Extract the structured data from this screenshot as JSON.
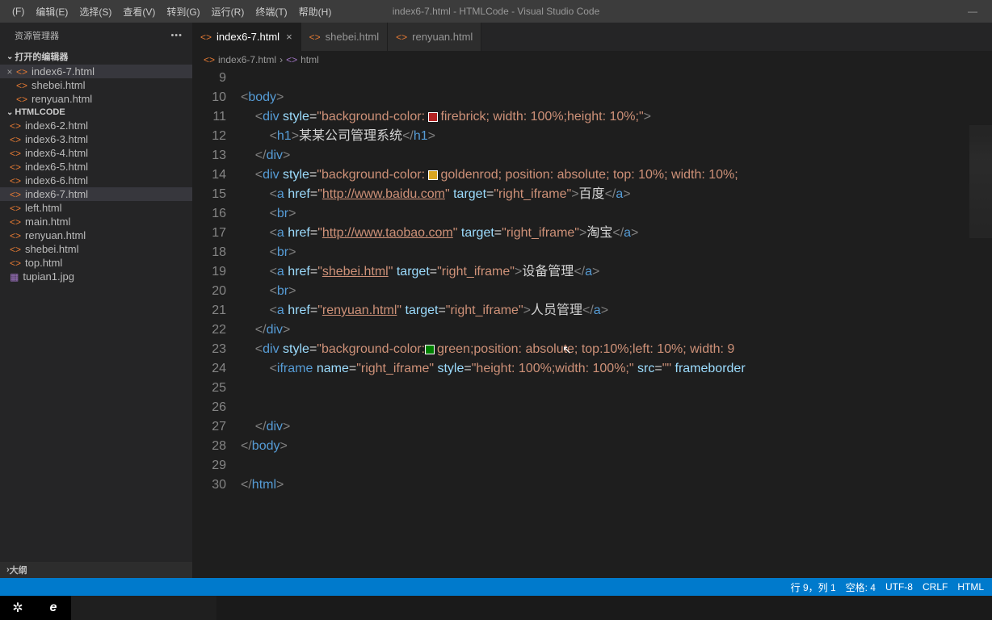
{
  "window": {
    "title": "index6-7.html - HTMLCode - Visual Studio Code"
  },
  "menubar": {
    "items": [
      "(F)",
      "编辑(E)",
      "选择(S)",
      "查看(V)",
      "转到(G)",
      "运行(R)",
      "终端(T)",
      "帮助(H)"
    ]
  },
  "sidebar": {
    "title": "资源管理器",
    "open_editors_label": "打开的编辑器",
    "open_editors": [
      {
        "name": "index6-7.html",
        "active": true
      },
      {
        "name": "shebei.html",
        "active": false
      },
      {
        "name": "renyuan.html",
        "active": false
      }
    ],
    "folder_label": "HTMLCODE",
    "files": [
      {
        "name": "index6-2.html",
        "type": "html",
        "active": false
      },
      {
        "name": "index6-3.html",
        "type": "html",
        "active": false
      },
      {
        "name": "index6-4.html",
        "type": "html",
        "active": false
      },
      {
        "name": "index6-5.html",
        "type": "html",
        "active": false
      },
      {
        "name": "index6-6.html",
        "type": "html",
        "active": false
      },
      {
        "name": "index6-7.html",
        "type": "html",
        "active": true
      },
      {
        "name": "left.html",
        "type": "html",
        "active": false
      },
      {
        "name": "main.html",
        "type": "html",
        "active": false
      },
      {
        "name": "renyuan.html",
        "type": "html",
        "active": false
      },
      {
        "name": "shebei.html",
        "type": "html",
        "active": false
      },
      {
        "name": "top.html",
        "type": "html",
        "active": false
      },
      {
        "name": "tupian1.jpg",
        "type": "img",
        "active": false
      }
    ],
    "outline_label": "大纲"
  },
  "tabs": [
    {
      "name": "index6-7.html",
      "active": true
    },
    {
      "name": "shebei.html",
      "active": false
    },
    {
      "name": "renyuan.html",
      "active": false
    }
  ],
  "breadcrumb": {
    "file": "index6-7.html",
    "symbol": "html"
  },
  "code_lines": {
    "start": 9,
    "end": 30,
    "body_text": "某某公司管理系统",
    "url1": "http://www.baidu.com",
    "url1_text": "百度",
    "url2": "http://www.taobao.com",
    "url2_text": "淘宝",
    "shebei_href": "shebei.html",
    "shebei_text": "设备管理",
    "renyuan_href": "renyuan.html",
    "renyuan_text": "人员管理",
    "target_val": "right_iframe",
    "color1": "firebrick",
    "color2": "goldenrod",
    "color3": "green",
    "style1": "; width: 100%;height: 10%;",
    "style2": "; position: absolute; top: 10%; width: 10%;",
    "style3": ";position: absolute; top:10%;left: 10%; width: 9",
    "iframe_style": "height: 100%;width: 100%;",
    "iframe_name": "right_iframe"
  },
  "statusbar": {
    "ln_col": "行 9，列 1",
    "spaces": "空格: 4",
    "encoding": "UTF-8",
    "eol": "CRLF",
    "lang": "HTML"
  }
}
